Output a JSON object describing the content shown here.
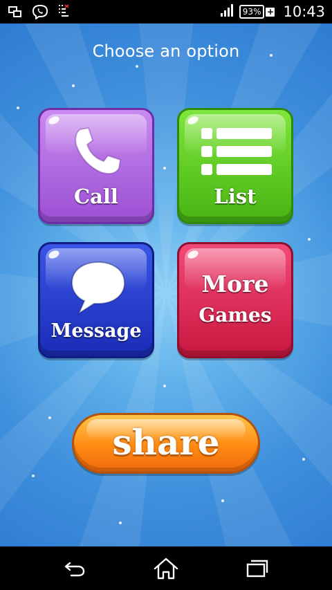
{
  "status_bar": {
    "battery_level": "93%",
    "time": "10:43",
    "icons": [
      "screen-mirror-icon",
      "viber-icon",
      "notification-icon",
      "signal-icon",
      "battery-icon",
      "charging-icon"
    ]
  },
  "screen": {
    "title": "Choose an option"
  },
  "options": {
    "call": {
      "label": "Call",
      "icon": "phone-icon",
      "color": "#a55ee0"
    },
    "list": {
      "label": "List",
      "icon": "list-icon",
      "color": "#5cc41f"
    },
    "message": {
      "label": "Message",
      "icon": "speech-bubble-icon",
      "color": "#2238c8"
    },
    "more_games": {
      "label_line1": "More",
      "label_line2": "Games",
      "color": "#e02a58"
    }
  },
  "share": {
    "label": "share",
    "color": "#ff8a12"
  },
  "nav_bar": {
    "icons": [
      "back-icon",
      "home-icon",
      "recent-apps-icon"
    ]
  }
}
